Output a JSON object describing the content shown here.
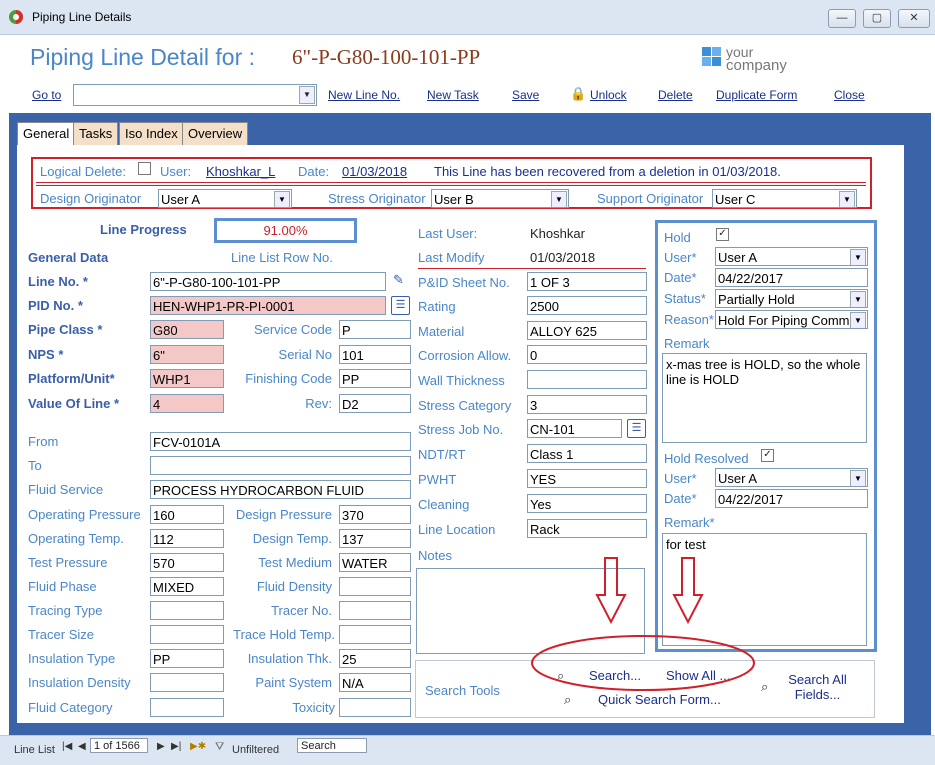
{
  "window": {
    "title": "Piping Line Details"
  },
  "header": {
    "title": "Piping Line Detail for :",
    "line_id": "6\"-P-G80-100-101-PP",
    "logo_line1": "your",
    "logo_line2": "company"
  },
  "toolbar": {
    "goto_label": "Go to",
    "goto_value": "",
    "new_line": "New Line No.",
    "new_task": "New Task",
    "save": "Save",
    "unlock": "Unlock",
    "delete": "Delete",
    "duplicate": "Duplicate Form",
    "close": "Close"
  },
  "tabs": [
    "General",
    "Tasks",
    "Iso Index",
    "Overview"
  ],
  "logical": {
    "logical_delete_label": "Logical Delete:",
    "user_label": "User:",
    "user_value": "Khoshkar_L",
    "date_label": "Date:",
    "date_value": "01/03/2018",
    "message": "This Line has been recovered from a deletion in 01/03/2018.",
    "design_originator_label": "Design Originator",
    "design_originator_value": "User A",
    "stress_originator_label": "Stress Originator",
    "stress_originator_value": "User B",
    "support_originator_label": "Support Originator",
    "support_originator_value": "User C"
  },
  "progress": {
    "label": "Line Progress",
    "value": "91.00%",
    "value_fraction": 0.91
  },
  "general": {
    "section_title": "General Data",
    "row_no_label": "Line List Row No.",
    "line_no_label": "Line No. *",
    "line_no_value": "6\"-P-G80-100-101-PP",
    "pid_no_label": "PID No. *",
    "pid_no_value": "HEN-WHP1-PR-PI-0001",
    "pipe_class_label": "Pipe Class *",
    "pipe_class_value": "G80",
    "service_code_label": "Service Code",
    "service_code_value": "P",
    "nps_label": "NPS *",
    "nps_value": "6\"",
    "serial_no_label": "Serial No",
    "serial_no_value": "101",
    "platform_label": "Platform/Unit*",
    "platform_value": "WHP1",
    "finishing_code_label": "Finishing Code",
    "finishing_code_value": "PP",
    "value_of_line_label": "Value Of Line *",
    "value_of_line_value": "4",
    "rev_label": "Rev:",
    "rev_value": "D2",
    "from_label": "From",
    "from_value": "FCV-0101A",
    "to_label": "To",
    "to_value": "",
    "fluid_service_label": "Fluid Service",
    "fluid_service_value": "PROCESS HYDROCARBON FLUID",
    "op_pressure_label": "Operating Pressure",
    "op_pressure_value": "160",
    "design_pressure_label": "Design Pressure",
    "design_pressure_value": "370",
    "op_temp_label": "Operating Temp.",
    "op_temp_value": "112",
    "design_temp_label": "Design Temp.",
    "design_temp_value": "137",
    "test_pressure_label": "Test Pressure",
    "test_pressure_value": "570",
    "test_medium_label": "Test Medium",
    "test_medium_value": "WATER",
    "fluid_phase_label": "Fluid Phase",
    "fluid_phase_value": "MIXED",
    "fluid_density_label": "Fluid Density",
    "fluid_density_value": "",
    "tracing_type_label": "Tracing Type",
    "tracing_type_value": "",
    "tracer_no_label": "Tracer No.",
    "tracer_no_value": "",
    "tracer_size_label": "Tracer Size",
    "tracer_size_value": "",
    "trace_hold_label": "Trace Hold Temp.",
    "trace_hold_value": "",
    "insulation_type_label": "Insulation Type",
    "insulation_type_value": "PP",
    "insulation_thk_label": "Insulation Thk.",
    "insulation_thk_value": "25",
    "insulation_density_label": "Insulation Density",
    "insulation_density_value": "",
    "paint_system_label": "Paint System",
    "paint_system_value": "N/A",
    "fluid_category_label": "Fluid Category",
    "fluid_category_value": "",
    "toxicity_label": "Toxicity",
    "toxicity_value": ""
  },
  "middle": {
    "last_user_label": "Last User:",
    "last_user_value": "Khoshkar",
    "last_modify_label": "Last Modify",
    "last_modify_value": "01/03/2018",
    "pid_sheet_label": "P&ID Sheet No.",
    "pid_sheet_value": "1 OF 3",
    "rating_label": "Rating",
    "rating_value": "2500",
    "material_label": "Material",
    "material_value": "ALLOY 625",
    "corrosion_label": "Corrosion Allow.",
    "corrosion_value": "0",
    "wall_thickness_label": "Wall Thickness",
    "wall_thickness_value": "",
    "stress_category_label": "Stress Category",
    "stress_category_value": "3",
    "stress_job_label": "Stress Job No.",
    "stress_job_value": "CN-101",
    "ndt_label": "NDT/RT",
    "ndt_value": "Class 1",
    "pwht_label": "PWHT",
    "pwht_value": "YES",
    "cleaning_label": "Cleaning",
    "cleaning_value": "Yes",
    "line_location_label": "Line Location",
    "line_location_value": "Rack",
    "notes_label": "Notes",
    "notes_value": ""
  },
  "hold": {
    "hold_label": "Hold",
    "user_label": "User*",
    "user_value": "User A",
    "date_label": "Date*",
    "date_value": "04/22/2017",
    "status_label": "Status*",
    "status_value": "Partially Hold",
    "reason_label": "Reason*",
    "reason_value": "Hold For Piping Comm",
    "remark_label": "Remark",
    "remark_value": "x-mas tree is HOLD, so the whole line is HOLD",
    "resolved_label": "Hold Resolved",
    "resolved_user_label": "User*",
    "resolved_user_value": "User A",
    "resolved_date_label": "Date*",
    "resolved_date_value": "04/22/2017",
    "resolved_remark_label": "Remark*",
    "resolved_remark_value": "for test"
  },
  "search": {
    "label": "Search Tools",
    "search": "Search...",
    "show_all": "Show All ...",
    "search_all": "Search All Fields...",
    "quick_search": "Quick Search Form..."
  },
  "statusbar": {
    "line_list": "Line List",
    "record": "1 of 1566",
    "filter": "Unfiltered",
    "search": "Search"
  },
  "colors": {
    "accent_blue": "#3b64a8",
    "label_blue": "#4a86c8",
    "highlight_red": "#d0202c",
    "required_pink": "#f5c8c8"
  }
}
